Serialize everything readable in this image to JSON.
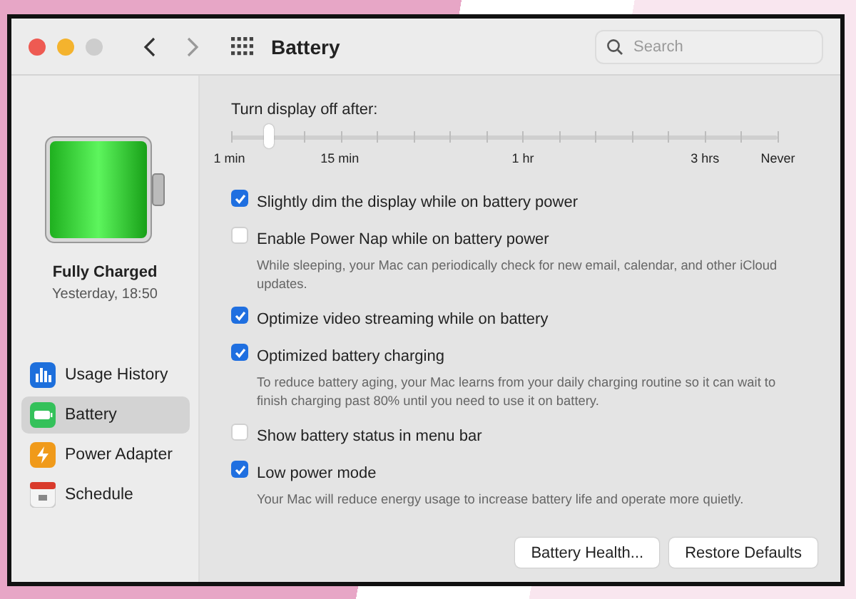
{
  "window": {
    "title": "Battery"
  },
  "search": {
    "placeholder": "Search"
  },
  "status": {
    "title": "Fully Charged",
    "time": "Yesterday, 18:50"
  },
  "sidebar": {
    "items": [
      {
        "kind": "usage",
        "label": "Usage History",
        "selected": false
      },
      {
        "kind": "battery",
        "label": "Battery",
        "selected": true
      },
      {
        "kind": "adapter",
        "label": "Power Adapter",
        "selected": false
      },
      {
        "kind": "schedule",
        "label": "Schedule",
        "selected": false
      }
    ]
  },
  "slider": {
    "label": "Turn display off after:",
    "level": 0.067,
    "ticks": [
      "1 min",
      "15 min",
      "1 hr",
      "3 hrs",
      "Never"
    ]
  },
  "options": [
    {
      "label": "Slightly dim the display while on battery power",
      "checked": true
    },
    {
      "label": "Enable Power Nap while on battery power",
      "checked": false,
      "description": "While sleeping, your Mac can periodically check for new email, calendar, and other iCloud updates."
    },
    {
      "label": "Optimize video streaming while on battery",
      "checked": true
    },
    {
      "label": "Optimized battery charging",
      "checked": true,
      "description": "To reduce battery aging, your Mac learns from your daily charging routine so it can wait to finish charging past 80% until you need to use it on battery."
    },
    {
      "label": "Show battery status in menu bar",
      "checked": false
    },
    {
      "label": "Low power mode",
      "checked": true,
      "description": "Your Mac will reduce energy usage to increase battery life and operate more quietly."
    }
  ],
  "buttons": [
    "Battery Health...",
    "Restore Defaults"
  ]
}
